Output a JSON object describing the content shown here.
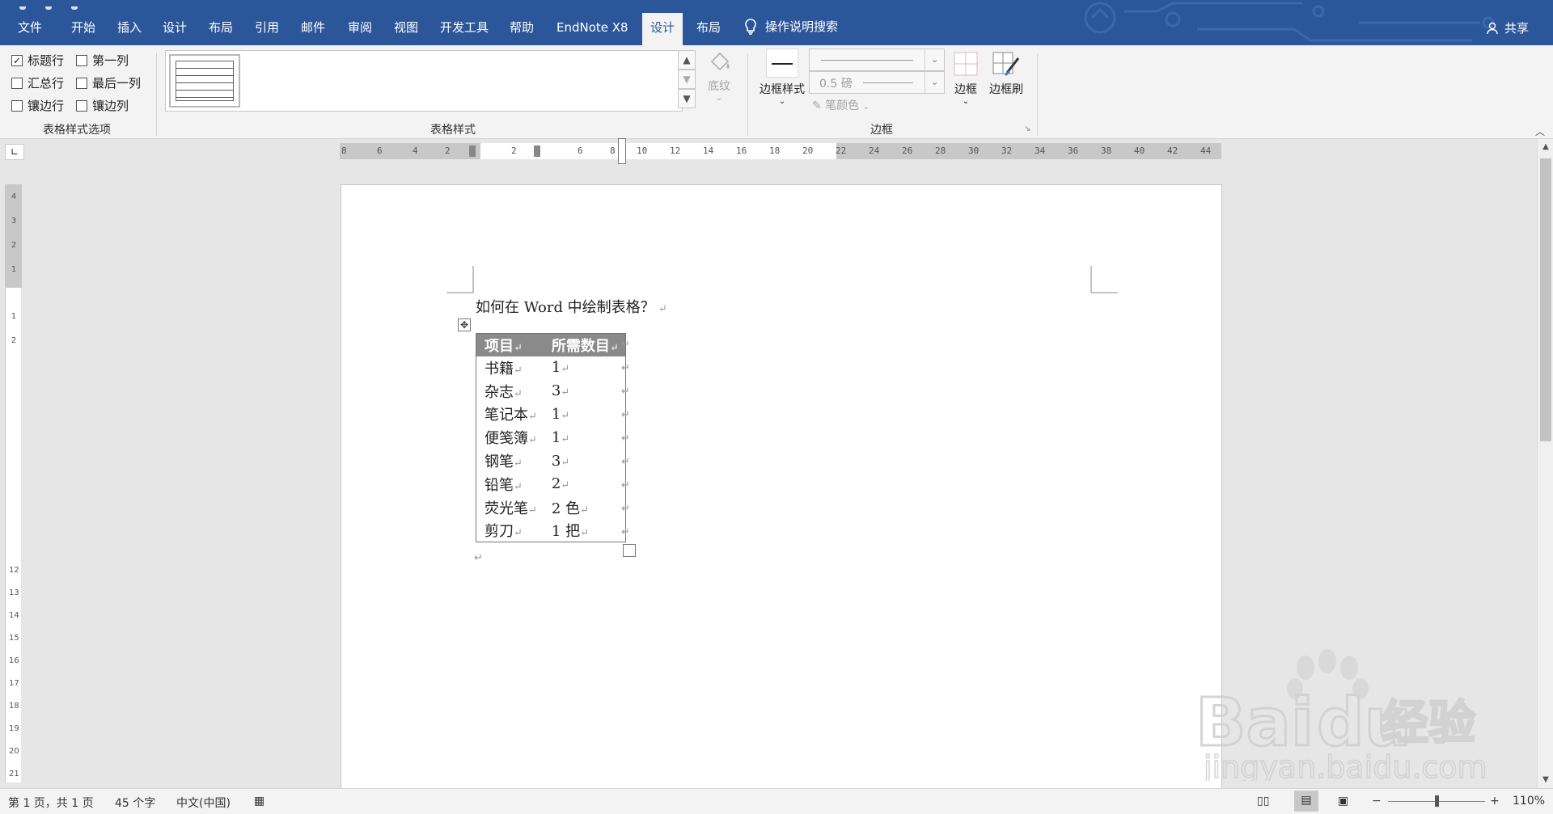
{
  "tabs": [
    "文件",
    "开始",
    "插入",
    "设计",
    "布局",
    "引用",
    "邮件",
    "审阅",
    "视图",
    "开发工具",
    "帮助",
    "EndNote X8",
    "设计",
    "布局"
  ],
  "search": "操作说明搜索",
  "share": "共享",
  "ribbon": {
    "options": {
      "header_row": "标题行",
      "first_column": "第一列",
      "total_row": "汇总行",
      "last_column": "最后一列",
      "banded_rows": "镶边行",
      "banded_columns": "镶边列",
      "group_label": "表格样式选项"
    },
    "styles_label": "表格样式",
    "shading": "底纹",
    "border_styles": "边框样式",
    "pen_weight": "0.5 磅",
    "pen_color": "笔颜色",
    "borders": "边框",
    "border_painter": "边框刷",
    "borders_group_label": "边框"
  },
  "ruler": {
    "left_ticks": [
      "8",
      "6",
      "4",
      "2",
      "2",
      "6",
      "8"
    ],
    "right_ticks": [
      "10",
      "12",
      "14",
      "16",
      "18",
      "20",
      "22",
      "24",
      "26",
      "28",
      "30",
      "32",
      "34",
      "36",
      "38",
      "40",
      "42",
      "44"
    ],
    "vertical_ticks": [
      "4",
      "3",
      "2",
      "1",
      "1",
      "2",
      "12",
      "13",
      "14",
      "15",
      "16",
      "17",
      "18",
      "19",
      "20",
      "21"
    ]
  },
  "document": {
    "title": "如何在 Word 中绘制表格？",
    "table_header": [
      "项目",
      "所需数目"
    ],
    "rows": [
      [
        "书籍",
        "1"
      ],
      [
        "杂志",
        "3"
      ],
      [
        "笔记本",
        "1"
      ],
      [
        "便笺簿",
        "1"
      ],
      [
        "钢笔",
        "3"
      ],
      [
        "铅笔",
        "2"
      ],
      [
        "荧光笔",
        "2 色"
      ],
      [
        "剪刀",
        "1 把"
      ]
    ]
  },
  "status": {
    "page": "第 1 页，共 1 页",
    "words": "45 个字",
    "language": "中文(中国)",
    "zoom": "110%"
  },
  "watermark": {
    "brand": "Bai",
    "brand2": "du",
    "cn": "经验",
    "url": "jingyan.baidu.com"
  },
  "colors": {
    "ribbon_blue": "#2b579a",
    "header_fill": "#8a8a8a"
  }
}
